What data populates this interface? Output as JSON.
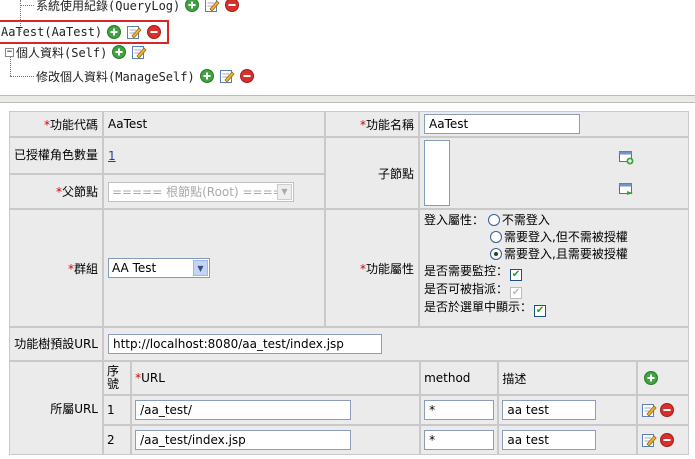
{
  "tree": {
    "nodes": [
      {
        "label": "系統使用紀錄(QueryLog)"
      },
      {
        "label": "AaTest(AaTest)"
      },
      {
        "label": "個人資料(Self)"
      },
      {
        "label": "修改個人資料(ManageSelf)"
      }
    ],
    "expander_symbol": "−",
    "icons": [
      "add-icon",
      "edit-icon",
      "delete-icon"
    ]
  },
  "form": {
    "required_mark": "*",
    "func_code_label": "功能代碼",
    "func_code_value": "AaTest",
    "func_name_label": "功能名稱",
    "func_name_value": "AaTest",
    "roles_label": "已授權角色數量",
    "roles_value": "1",
    "child_label": "子節點",
    "parent_label": "父節點",
    "parent_value": "===== 根節點(Root) =====",
    "group_label": "群組",
    "group_value": "AA Test",
    "attr_label": "功能屬性",
    "login_attr_label": "登入屬性：",
    "login_options": [
      "不需登入",
      "需要登入,但不需被授權",
      "需要登入,且需要被授權"
    ],
    "login_selected": 2,
    "monitor_label": "是否需要監控：",
    "assign_label": "是否可被指派：",
    "menu_label": "是否於選單中顯示：",
    "default_url_label": "功能樹預設URL",
    "default_url_value": "http://localhost:8080/aa_test/index.jsp",
    "url_label": "所屬URL",
    "url_table": {
      "headers": {
        "seq": "序號",
        "url": "URL",
        "method": "method",
        "desc": "描述"
      },
      "rows": [
        {
          "seq": "1",
          "url": "/aa_test/",
          "method": "*",
          "desc": "aa test"
        },
        {
          "seq": "2",
          "url": "/aa_test/index.jsp",
          "method": "*",
          "desc": "aa test"
        }
      ]
    }
  },
  "colors": {
    "add": "#3fa33f",
    "delete": "#d9302c",
    "selection": "#d6252b"
  }
}
